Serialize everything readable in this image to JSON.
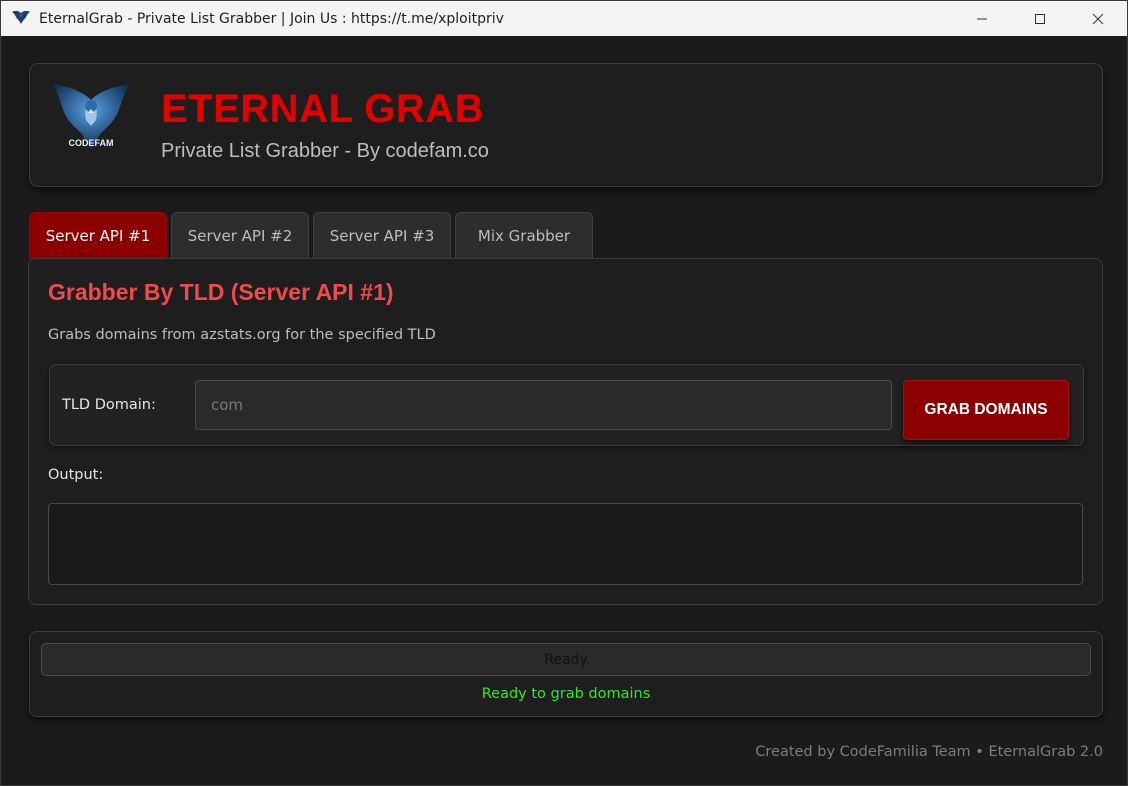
{
  "window": {
    "title": "EternalGrab - Private List Grabber | Join Us : https://t.me/xploitpriv",
    "icon": "eagle-icon"
  },
  "header": {
    "title": "ETERNAL GRAB",
    "subtitle": "Private List Grabber - By codefam.co",
    "logo_text": "CODEFAM",
    "title_color": "#e50000"
  },
  "tabs": [
    {
      "label": "Server API #1",
      "active": true
    },
    {
      "label": "Server API #2",
      "active": false
    },
    {
      "label": "Server API #3",
      "active": false
    },
    {
      "label": "Mix Grabber",
      "active": false
    }
  ],
  "panel": {
    "title": "Grabber By TLD (Server API #1)",
    "description": "Grabs domains from azstats.org for the specified TLD",
    "tld_label": "TLD Domain:",
    "tld_placeholder": "com",
    "tld_value": "",
    "grab_button": "GRAB DOMAINS",
    "output_label": "Output:",
    "output_value": ""
  },
  "status": {
    "progress_text": "Ready",
    "progress_percent": 0,
    "message": "Ready to grab domains",
    "message_color": "#2ee82e"
  },
  "footer": {
    "credit": "Created by CodeFamilia Team • EternalGrab 2.0"
  },
  "colors": {
    "accent": "#8b0000",
    "background": "#1b1b1b"
  }
}
